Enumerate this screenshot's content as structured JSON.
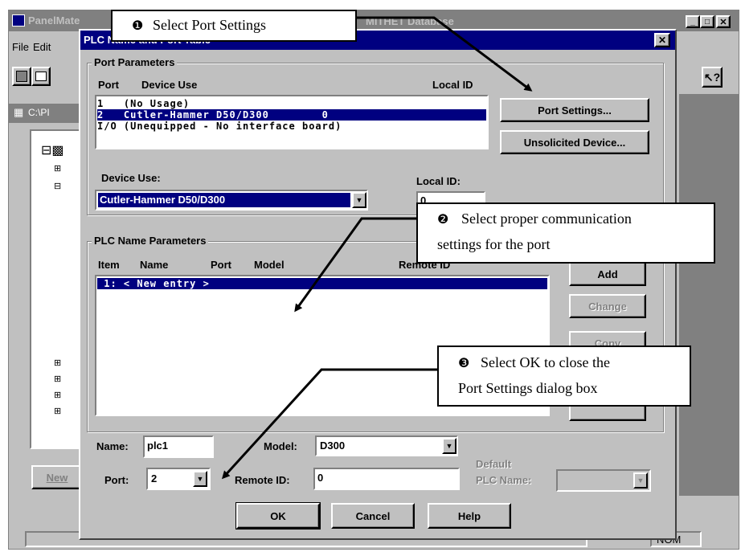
{
  "app": {
    "title": "PanelMate",
    "title_right": "MITHET Database"
  },
  "menu": [
    "File",
    "Edit"
  ],
  "tree_path": "C:\\PI",
  "background_button": "New",
  "status_right": "NOM",
  "dialog": {
    "title": "PLC Name and Port Table",
    "port_parameters": {
      "label": "Port Parameters",
      "headers": {
        "port": "Port",
        "device_use": "Device Use",
        "local_id": "Local ID"
      },
      "rows": [
        {
          "text": "1   (No Usage)",
          "selected": false
        },
        {
          "text": "2   Cutler-Hammer D50/D300        0",
          "selected": true
        },
        {
          "text": "I/O (Unequipped - No interface board)",
          "selected": false
        }
      ],
      "port_settings_button": "Port Settings...",
      "unsolicited_device_button": "Unsolicited Device...",
      "device_use_label": "Device Use:",
      "device_use_value": "Cutler-Hammer D50/D300",
      "local_id_label": "Local ID:",
      "local_id_value": "0"
    },
    "plc_name_parameters": {
      "label": "PLC Name Parameters",
      "headers": {
        "item": "Item",
        "name": "Name",
        "port": "Port",
        "model": "Model",
        "remote_id": "Remote ID"
      },
      "rows": [
        {
          "text": " 1: < New entry >",
          "selected": true
        }
      ],
      "buttons": {
        "add": "Add",
        "change": "Change",
        "copy": "Copy"
      }
    },
    "fields": {
      "name_label": "Name:",
      "name_value": "plc1",
      "model_label": "Model:",
      "model_value": "D300",
      "port_label": "Port:",
      "port_value": "2",
      "remote_id_label": "Remote ID:",
      "remote_id_value": "0",
      "default_label_1": "Default",
      "default_label_2": "PLC Name:"
    },
    "buttons": {
      "ok": "OK",
      "cancel": "Cancel",
      "help": "Help"
    }
  },
  "callouts": {
    "one": {
      "num": "❶",
      "text": "Select Port Settings"
    },
    "two": {
      "num": "❷",
      "text_1": "Select proper communication",
      "text_2": "settings for the port"
    },
    "three": {
      "num": "❸",
      "text_1": "Select OK to close the",
      "text_2": "Port Settings dialog box"
    }
  }
}
